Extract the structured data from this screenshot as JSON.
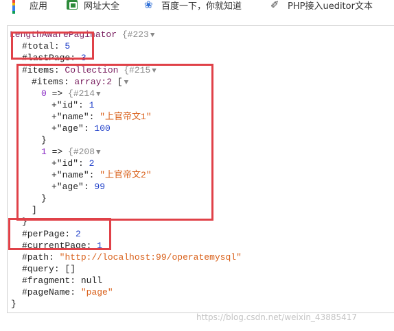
{
  "bookmarks": [
    {
      "label": "应用",
      "icon": "apps-grid-icon"
    },
    {
      "label": "网址大全",
      "icon": "site-directory-icon"
    },
    {
      "label": "百度一下，你就知道",
      "icon": "baidu-paw-icon"
    },
    {
      "label": "PHP接入ueditor文本",
      "icon": "php-doc-icon"
    }
  ],
  "dump": {
    "class_name": "LengthAwarePaginator",
    "object_id": "{#223",
    "total_key": "#total",
    "total_value": "5",
    "last_page_key": "#lastPage",
    "last_page_value": "3",
    "items_key": "#items",
    "items_class": "Collection",
    "items_object_id": "{#215",
    "inner_items_key": "#items",
    "inner_items_type": "array:2",
    "entries": [
      {
        "index": "0",
        "object_id": "{#214",
        "fields": [
          {
            "key": "id",
            "value": "1",
            "type": "num"
          },
          {
            "key": "name",
            "value": "上官帝文1",
            "type": "str"
          },
          {
            "key": "age",
            "value": "100",
            "type": "num"
          }
        ]
      },
      {
        "index": "1",
        "object_id": "{#208",
        "fields": [
          {
            "key": "id",
            "value": "2",
            "type": "num"
          },
          {
            "key": "name",
            "value": "上官帝文2",
            "type": "str"
          },
          {
            "key": "age",
            "value": "99",
            "type": "num"
          }
        ]
      }
    ],
    "per_page_key": "#perPage",
    "per_page_value": "2",
    "current_page_key": "#currentPage",
    "current_page_value": "1",
    "path_key": "#path",
    "path_value": "http://localhost:99/operatemysql",
    "query_key": "#query",
    "query_value": "[]",
    "fragment_key": "#fragment",
    "fragment_value": "null",
    "page_name_key": "#pageName",
    "page_name_value": "page"
  },
  "watermark": "https://blog.csdn.net/weixin_43885417",
  "colors": {
    "highlight": "#e04148",
    "string": "#d9601a",
    "number": "#1f3fc9",
    "class": "#7a2060"
  }
}
